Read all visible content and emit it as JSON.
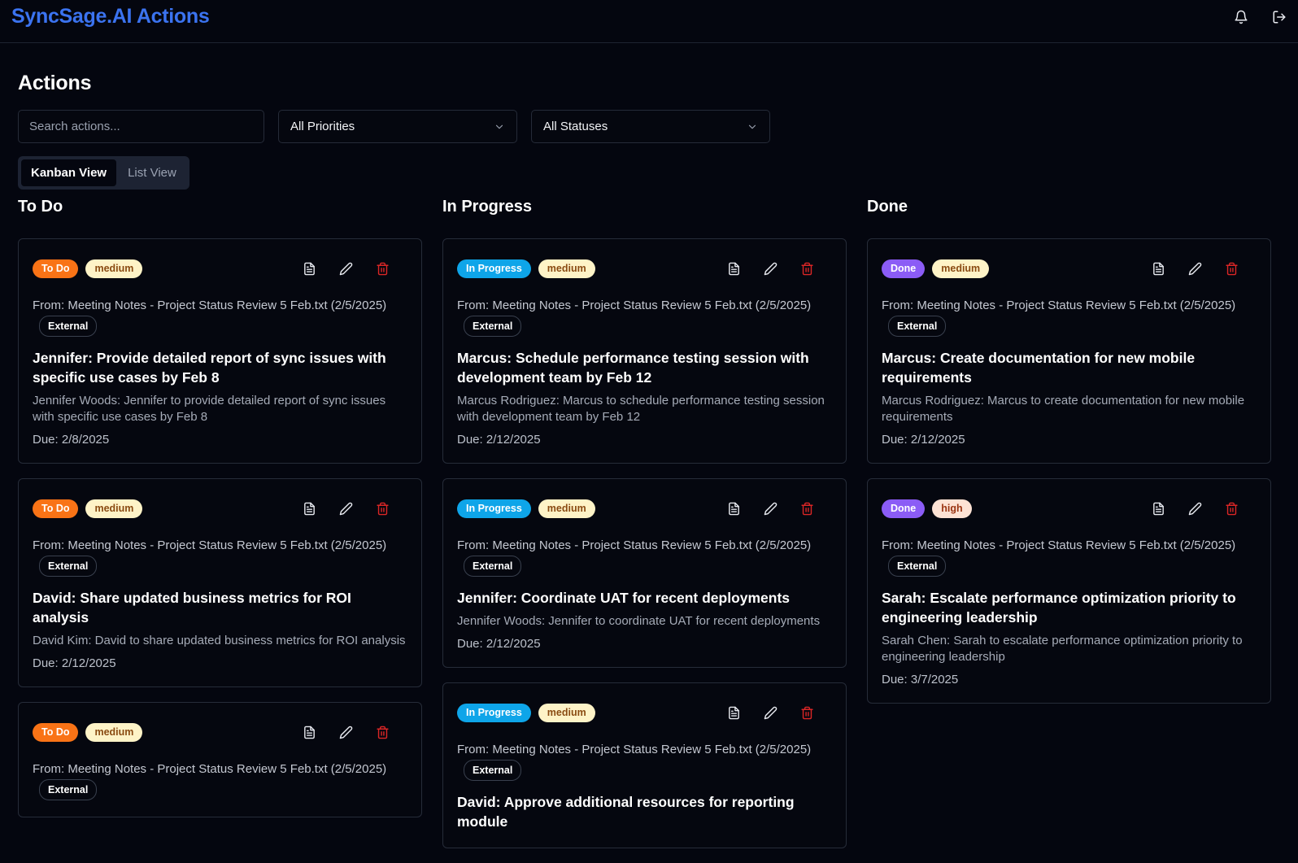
{
  "app": {
    "title": "SyncSage.AI Actions"
  },
  "page": {
    "title": "Actions"
  },
  "filters": {
    "search_placeholder": "Search actions...",
    "priority": "All Priorities",
    "status": "All Statuses"
  },
  "views": {
    "kanban": "Kanban View",
    "list": "List View",
    "active": "kanban"
  },
  "colors": {
    "brand": "#3b73f0",
    "todo": "#f97316",
    "in_progress": "#0ea5e9",
    "done": "#8b5cf6",
    "medium": "#fef3c7",
    "high": "#fde2d4",
    "delete": "#dc2626"
  },
  "columns": [
    {
      "title": "To Do",
      "cards": [
        {
          "status": "To Do",
          "priority": "medium",
          "from": "From: Meeting Notes - Project Status Review 5 Feb.txt (2/5/2025)",
          "tag": "External",
          "title": "Jennifer: Provide detailed report of sync issues with specific use cases by Feb 8",
          "desc": "Jennifer Woods: Jennifer to provide detailed report of sync issues with specific use cases by Feb 8",
          "due": "Due: 2/8/2025"
        },
        {
          "status": "To Do",
          "priority": "medium",
          "from": "From: Meeting Notes - Project Status Review 5 Feb.txt (2/5/2025)",
          "tag": "External",
          "title": "David: Share updated business metrics for ROI analysis",
          "desc": "David Kim: David to share updated business metrics for ROI analysis",
          "due": "Due: 2/12/2025"
        },
        {
          "status": "To Do",
          "priority": "medium",
          "from": "From: Meeting Notes - Project Status Review 5 Feb.txt (2/5/2025)",
          "tag": "External"
        }
      ]
    },
    {
      "title": "In Progress",
      "cards": [
        {
          "status": "In Progress",
          "priority": "medium",
          "from": "From: Meeting Notes - Project Status Review 5 Feb.txt (2/5/2025)",
          "tag": "External",
          "title": "Marcus: Schedule performance testing session with development team by Feb 12",
          "desc": "Marcus Rodriguez: Marcus to schedule performance testing session with development team by Feb 12",
          "due": "Due: 2/12/2025"
        },
        {
          "status": "In Progress",
          "priority": "medium",
          "from": "From: Meeting Notes - Project Status Review 5 Feb.txt (2/5/2025)",
          "tag": "External",
          "title": "Jennifer: Coordinate UAT for recent deployments",
          "desc": "Jennifer Woods: Jennifer to coordinate UAT for recent deployments",
          "due": "Due: 2/12/2025"
        },
        {
          "status": "In Progress",
          "priority": "medium",
          "from": "From: Meeting Notes - Project Status Review 5 Feb.txt (2/5/2025)",
          "tag": "External",
          "title": "David: Approve additional resources for reporting module"
        }
      ]
    },
    {
      "title": "Done",
      "cards": [
        {
          "status": "Done",
          "priority": "medium",
          "from": "From: Meeting Notes - Project Status Review 5 Feb.txt (2/5/2025)",
          "tag": "External",
          "title": "Marcus: Create documentation for new mobile requirements",
          "desc": "Marcus Rodriguez: Marcus to create documentation for new mobile requirements",
          "due": "Due: 2/12/2025"
        },
        {
          "status": "Done",
          "priority": "high",
          "from": "From: Meeting Notes - Project Status Review 5 Feb.txt (2/5/2025)",
          "tag": "External",
          "title": "Sarah: Escalate performance optimization priority to engineering leadership",
          "desc": "Sarah Chen: Sarah to escalate performance optimization priority to engineering leadership",
          "due": "Due: 3/7/2025"
        }
      ]
    }
  ]
}
